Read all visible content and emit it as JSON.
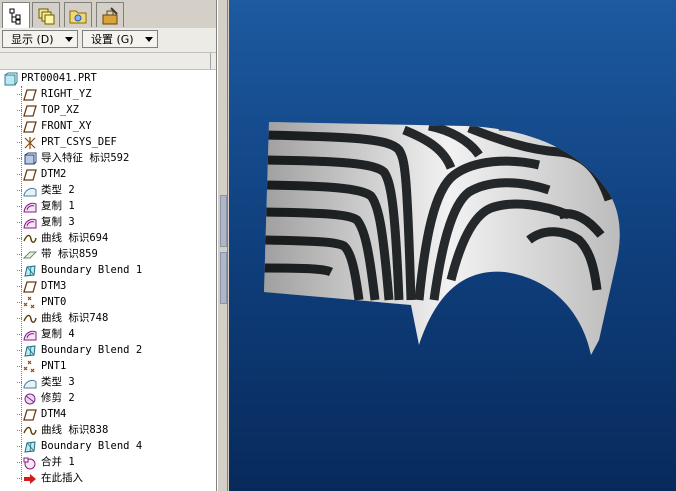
{
  "tabs": [
    {
      "name": "model-tree-tab",
      "icon": "model-tree-icon"
    },
    {
      "name": "layers-tab",
      "icon": "layers-icon"
    },
    {
      "name": "folder-tab",
      "icon": "folder-icon"
    },
    {
      "name": "favorites-tab",
      "icon": "toolbox-icon"
    }
  ],
  "toolbar": {
    "display_label": "显示 (D)",
    "settings_label": "设置 (G)"
  },
  "tree": {
    "root": "PRT00041.PRT",
    "items": [
      {
        "label": "RIGHT_YZ",
        "icon": "datum-plane-icon"
      },
      {
        "label": "TOP_XZ",
        "icon": "datum-plane-icon"
      },
      {
        "label": "FRONT_XY",
        "icon": "datum-plane-icon"
      },
      {
        "label": "PRT_CSYS_DEF",
        "icon": "csys-icon"
      },
      {
        "label": "导入特征 标识592",
        "icon": "import-feature-icon"
      },
      {
        "label": "DTM2",
        "icon": "datum-plane-icon"
      },
      {
        "label": "类型 2",
        "icon": "surface-type-icon"
      },
      {
        "label": "复制 1",
        "icon": "copy-surface-icon"
      },
      {
        "label": "复制 3",
        "icon": "copy-surface-icon"
      },
      {
        "label": "曲线 标识694",
        "icon": "curve-icon"
      },
      {
        "label": "带 标识859",
        "icon": "ribbon-icon"
      },
      {
        "label": "Boundary Blend 1",
        "icon": "boundary-blend-icon"
      },
      {
        "label": "DTM3",
        "icon": "datum-plane-icon"
      },
      {
        "label": "PNT0",
        "icon": "datum-point-icon"
      },
      {
        "label": "曲线 标识748",
        "icon": "curve-icon"
      },
      {
        "label": "复制 4",
        "icon": "copy-surface-icon"
      },
      {
        "label": "Boundary Blend 2",
        "icon": "boundary-blend-icon"
      },
      {
        "label": "PNT1",
        "icon": "datum-point-icon"
      },
      {
        "label": "类型 3",
        "icon": "surface-type-icon"
      },
      {
        "label": "修剪 2",
        "icon": "trim-icon"
      },
      {
        "label": "DTM4",
        "icon": "datum-plane-icon"
      },
      {
        "label": "曲线 标识838",
        "icon": "curve-icon"
      },
      {
        "label": "Boundary Blend 4",
        "icon": "boundary-blend-icon"
      },
      {
        "label": "合并 1",
        "icon": "merge-icon"
      },
      {
        "label": "在此插入",
        "icon": "insert-here-arrow-icon"
      }
    ]
  },
  "viewport": {
    "background_top": "#1d5aa0",
    "background_bottom": "#082a5b"
  }
}
